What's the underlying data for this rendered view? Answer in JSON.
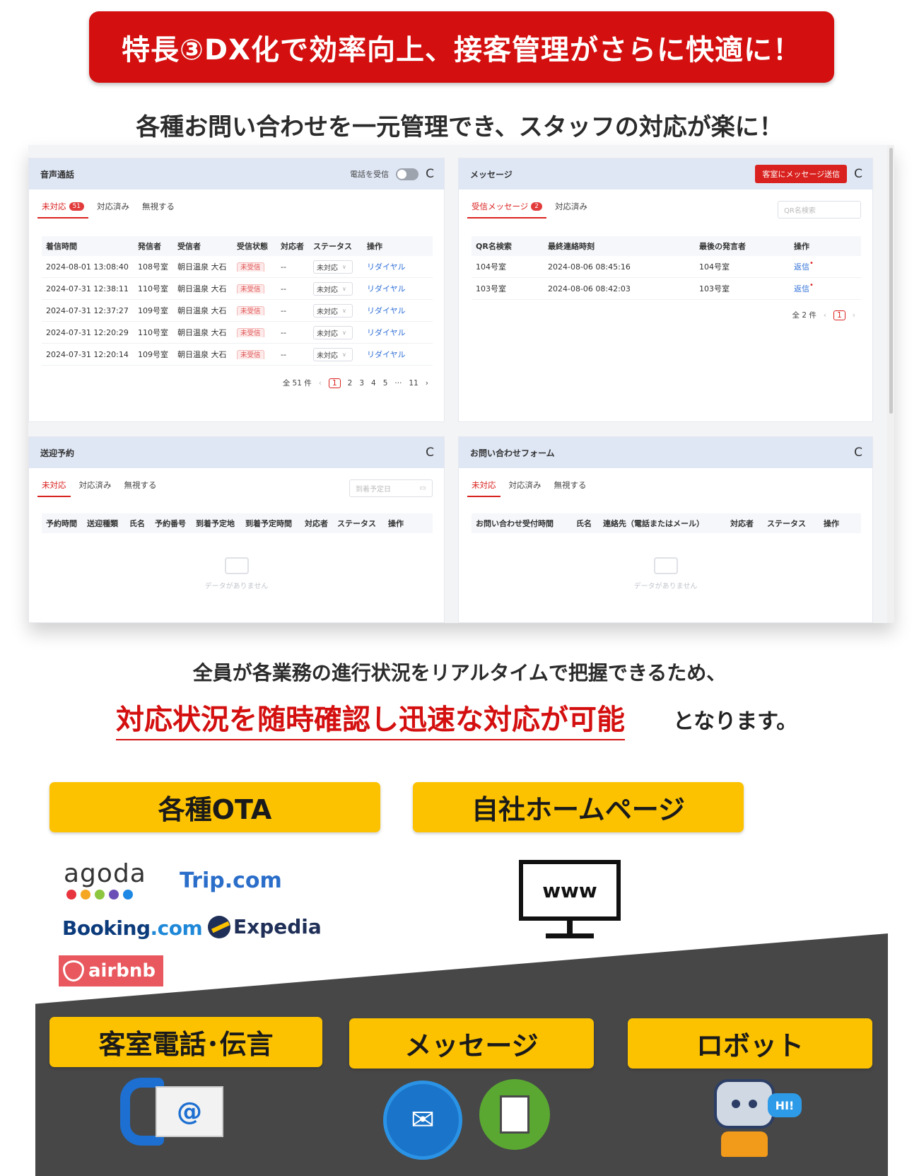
{
  "title": "特長③DX化で効率向上、接客管理がさらに快適に！",
  "subtitle": "各種お問い合わせを一元管理でき、スタッフの対応が楽に！",
  "dashboard": {
    "voice": {
      "title": "音声通話",
      "toggle_label": "電話を受信",
      "tabs": [
        {
          "label": "未対応",
          "badge": "51"
        },
        {
          "label": "対応済み"
        },
        {
          "label": "無視する"
        }
      ],
      "columns": [
        "着信時間",
        "発信者",
        "受信者",
        "受信状態",
        "対応者",
        "ステータス",
        "操作"
      ],
      "rows": [
        {
          "time": "2024-08-01 13:08:40",
          "caller": "108号室",
          "receiver": "朝日温泉 大石",
          "state": "未受信",
          "handler": "--",
          "status": "未対応",
          "action": "リダイヤル"
        },
        {
          "time": "2024-07-31 12:38:11",
          "caller": "110号室",
          "receiver": "朝日温泉 大石",
          "state": "未受信",
          "handler": "--",
          "status": "未対応",
          "action": "リダイヤル"
        },
        {
          "time": "2024-07-31 12:37:27",
          "caller": "109号室",
          "receiver": "朝日温泉 大石",
          "state": "未受信",
          "handler": "--",
          "status": "未対応",
          "action": "リダイヤル"
        },
        {
          "time": "2024-07-31 12:20:29",
          "caller": "110号室",
          "receiver": "朝日温泉 大石",
          "state": "未受信",
          "handler": "--",
          "status": "未対応",
          "action": "リダイヤル"
        },
        {
          "time": "2024-07-31 12:20:14",
          "caller": "109号室",
          "receiver": "朝日温泉 大石",
          "state": "未受信",
          "handler": "--",
          "status": "未対応",
          "action": "リダイヤル"
        }
      ],
      "pager": {
        "total": "全 51 件",
        "prev": "‹",
        "current": "1",
        "pages": [
          "2",
          "3",
          "4",
          "5",
          "···",
          "11"
        ],
        "next": "›"
      }
    },
    "message": {
      "title": "メッセージ",
      "send_button": "客室にメッセージ送信",
      "tabs": [
        {
          "label": "受信メッセージ",
          "badge": "2"
        },
        {
          "label": "対応済み"
        }
      ],
      "search_placeholder": "QR名検索",
      "columns": [
        "QR名検索",
        "最終連絡時刻",
        "最後の発言者",
        "操作"
      ],
      "rows": [
        {
          "qr": "104号室",
          "time": "2024-08-06 08:45:16",
          "last": "104号室",
          "action": "返信"
        },
        {
          "qr": "103号室",
          "time": "2024-08-06 08:42:03",
          "last": "103号室",
          "action": "返信"
        }
      ],
      "pager": {
        "total": "全 2 件",
        "prev": "‹",
        "current": "1",
        "next": "›"
      }
    },
    "shuttle": {
      "title": "送迎予約",
      "tabs": [
        {
          "label": "未対応"
        },
        {
          "label": "対応済み"
        },
        {
          "label": "無視する"
        }
      ],
      "date_placeholder": "到着予定日",
      "columns": [
        "予約時間",
        "送迎種類",
        "氏名",
        "予約番号",
        "到着予定地",
        "到着予定時間",
        "対応者",
        "ステータス",
        "操作"
      ],
      "empty": "データがありません"
    },
    "inquiry": {
      "title": "お問い合わせフォーム",
      "tabs": [
        {
          "label": "未対応"
        },
        {
          "label": "対応済み"
        },
        {
          "label": "無視する"
        }
      ],
      "columns": [
        "お問い合わせ受付時間",
        "氏名",
        "連絡先（電話またはメール）",
        "対応者",
        "ステータス",
        "操作"
      ],
      "empty": "データがありません"
    }
  },
  "lead_line1": "全員が各業務の進行状況をリアルタイムで把握できるため、",
  "lead_line2_highlight": "対応状況を随時確認し迅速な対応が可能",
  "lead_line2_rest": "となります。",
  "buttons": {
    "ota": "各種OTA",
    "homepage": "自社ホームページ",
    "phone": "客室電話･伝言",
    "message": "メッセージ",
    "robot": "ロボット"
  },
  "logos": {
    "agoda": "agoda",
    "trip": "Trip.com",
    "booking_main": "Booking",
    "booking_dot": ".com",
    "expedia": "Expedia",
    "airbnb": "airbnb"
  },
  "icons": {
    "www": "www",
    "mail_at": "@",
    "hi": "HI!",
    "refresh": "C"
  },
  "colors": {
    "brand_red": "#d40f0f",
    "yellow": "#fcc200",
    "dark_gray": "#474747",
    "link_blue": "#2f6fd6",
    "agoda_dots": [
      "#e8343e",
      "#f5a623",
      "#8dc63f",
      "#6c4fb6",
      "#1e88e5"
    ]
  }
}
